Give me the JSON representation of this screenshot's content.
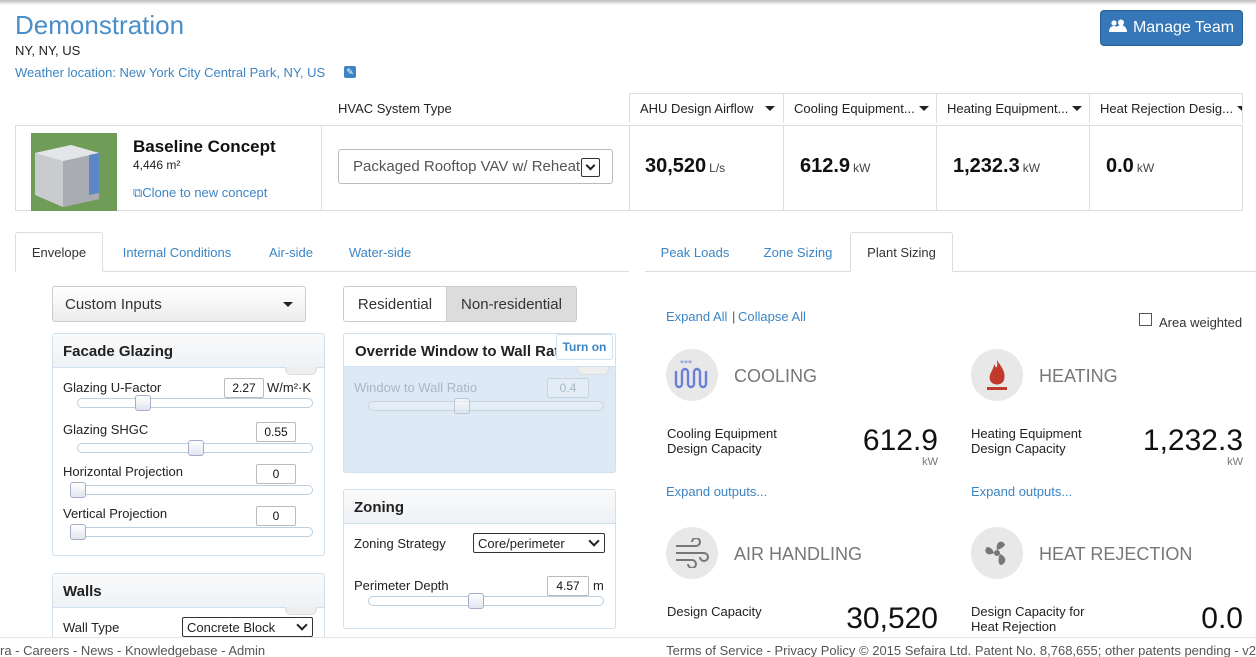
{
  "header": {
    "title": "Demonstration",
    "location": "NY, NY, US",
    "weather": "Weather location: New York City Central Park, NY, US",
    "manage_team": "Manage Team"
  },
  "concept": {
    "name": "Baseline Concept",
    "area": "4,446 m²",
    "clone_label": "Clone to new concept",
    "hvac_label": "HVAC System Type",
    "hvac_value": "Packaged Rooftop VAV w/ Reheat"
  },
  "metrics": [
    {
      "header": "AHU Design Airflow",
      "value": "30,520",
      "unit": "L/s"
    },
    {
      "header": "Cooling Equipment...",
      "value": "612.9",
      "unit": "kW"
    },
    {
      "header": "Heating Equipment...",
      "value": "1,232.3",
      "unit": "kW"
    },
    {
      "header": "Heat Rejection Desig...",
      "value": "0.0",
      "unit": "kW"
    }
  ],
  "left_tabs": [
    "Envelope",
    "Internal Conditions",
    "Air-side",
    "Water-side"
  ],
  "right_tabs": [
    "Peak Loads",
    "Zone Sizing",
    "Plant Sizing"
  ],
  "inputs": {
    "preset": "Custom Inputs",
    "residential": "Residential",
    "non_residential": "Non-residential"
  },
  "facade": {
    "title": "Facade Glazing",
    "u_label": "Glazing U-Factor",
    "u_value": "2.27",
    "u_unit": "W/m²·K",
    "shgc_label": "Glazing SHGC",
    "shgc_value": "0.55",
    "hproj_label": "Horizontal Projection",
    "hproj_value": "0",
    "vproj_label": "Vertical Projection",
    "vproj_value": "0"
  },
  "override": {
    "title": "Override Window to Wall Ratio",
    "turn_on": "Turn on",
    "wwr_label": "Window to Wall Ratio",
    "wwr_value": "0.4"
  },
  "zoning": {
    "title": "Zoning",
    "strategy_label": "Zoning Strategy",
    "strategy_value": "Core/perimeter",
    "depth_label": "Perimeter Depth",
    "depth_value": "4.57",
    "depth_unit": "m"
  },
  "walls": {
    "title": "Walls",
    "type_label": "Wall Type",
    "type_value": "Concrete Block"
  },
  "plant": {
    "expand_all": "Expand All",
    "sep": "|",
    "collapse_all": "Collapse All",
    "area_weighted": "Area weighted",
    "cooling": {
      "title": "COOLING",
      "label1": "Cooling Equipment",
      "label2": "Design Capacity",
      "value": "612.9",
      "unit": "kW",
      "expand": "Expand outputs..."
    },
    "heating": {
      "title": "HEATING",
      "label1": "Heating Equipment",
      "label2": "Design Capacity",
      "value": "1,232.3",
      "unit": "kW",
      "expand": "Expand outputs..."
    },
    "air": {
      "title": "AIR HANDLING",
      "label1": "Design Capacity",
      "value": "30,520"
    },
    "rejection": {
      "title": "HEAT REJECTION",
      "label1": "Design Capacity for",
      "label2": "Heat Rejection",
      "value": "0.0"
    }
  },
  "footer": {
    "left": "ra - Careers - News - Knowledgebase - Admin",
    "right": "Terms of Service - Privacy Policy © 2015 Sefaira Ltd. Patent No. 8,768,655; other patents pending - v2"
  },
  "colors": {
    "accent": "#3c84c4",
    "button": "#3577b8",
    "heating_red": "#c0392b",
    "cooling_blue": "#6a7fd8"
  }
}
